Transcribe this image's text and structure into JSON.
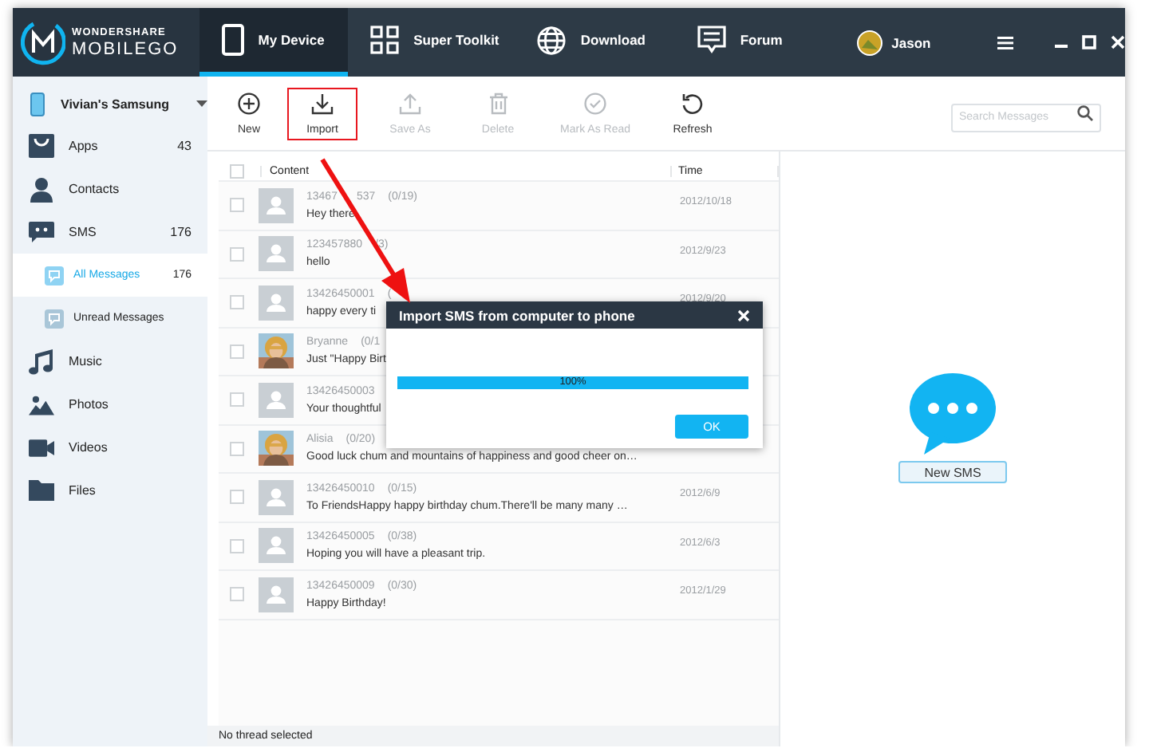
{
  "app": {
    "logo_top": "WONDERSHARE",
    "logo_bottom": "MOBILEGO"
  },
  "nav_tabs": [
    {
      "label": "My Device",
      "selected": true
    },
    {
      "label": "Super Toolkit",
      "selected": false
    },
    {
      "label": "Download",
      "selected": false
    },
    {
      "label": "Forum",
      "selected": false
    }
  ],
  "user": {
    "name": "Jason"
  },
  "sidebar": {
    "device": "Vivian's Samsung",
    "items": [
      {
        "label": "Apps",
        "count": "43",
        "selected": false
      },
      {
        "label": "Contacts",
        "selected": false
      },
      {
        "label": "SMS",
        "count": "176",
        "selected": false,
        "children": [
          {
            "label": "All Messages",
            "count": "176",
            "selected": true
          },
          {
            "label": "Unread Messages",
            "selected": false
          }
        ]
      },
      {
        "label": "Music",
        "selected": false
      },
      {
        "label": "Photos",
        "selected": false
      },
      {
        "label": "Videos",
        "selected": false
      },
      {
        "label": "Files",
        "selected": false
      }
    ]
  },
  "toolbar": {
    "buttons": [
      {
        "label": "New",
        "disabled": false,
        "highlighted": false
      },
      {
        "label": "Import",
        "disabled": false,
        "highlighted": true
      },
      {
        "label": "Save As",
        "disabled": true,
        "highlighted": false
      },
      {
        "label": "Delete",
        "disabled": true,
        "highlighted": false
      },
      {
        "label": "Mark As Read",
        "disabled": true,
        "highlighted": false
      },
      {
        "label": "Refresh",
        "disabled": false,
        "highlighted": false
      }
    ],
    "search": {
      "placeholder": "Search Messages"
    }
  },
  "table": {
    "all_checked": false,
    "columns": [
      "Content",
      "Time"
    ],
    "rows": [
      {
        "kind": "contact",
        "sender": "13467",
        "sender_end": "537",
        "count": "(0/19)",
        "text": "Hey there",
        "time": "2012/10/18",
        "checked": false
      },
      {
        "kind": "contact",
        "sender": "123457880",
        "count": "/3)",
        "text": "hello",
        "time": "2012/9/23",
        "checked": false
      },
      {
        "kind": "contact",
        "sender": "13426450001",
        "count": "(",
        "text": "happy every ti",
        "time": "2012/9/20",
        "checked": false
      },
      {
        "kind": "picture",
        "sender": "Bryanne",
        "count": "(0/1",
        "text": "Just \"Happy Birt",
        "checked": false
      },
      {
        "kind": "contact",
        "sender": "13426450003",
        "text": "Your thoughtful",
        "checked": false
      },
      {
        "kind": "picture",
        "sender": "Alisia",
        "count": "(0/20)",
        "text": "Good luck chum and mountains of happiness and good cheer on…",
        "checked": false
      },
      {
        "kind": "contact",
        "sender": "13426450010",
        "count": "(0/15)",
        "text": "To FriendsHappy happy birthday chum.There'll be many many …",
        "time": "2012/6/9",
        "checked": false
      },
      {
        "kind": "contact",
        "sender": "13426450005",
        "count": "(0/38)",
        "text": "Hoping you will have a pleasant trip.",
        "time": "2012/6/3",
        "checked": false
      },
      {
        "kind": "contact",
        "sender": "13426450009",
        "count": "(0/30)",
        "text": "Happy Birthday!",
        "time": "2012/1/29",
        "checked": false
      }
    ]
  },
  "status_bar": "No thread selected",
  "right_panel": {
    "button": "New SMS"
  },
  "dialog": {
    "title": "Import SMS from computer to phone",
    "progress": {
      "level": 1,
      "reading": "100%"
    },
    "button": "OK"
  }
}
